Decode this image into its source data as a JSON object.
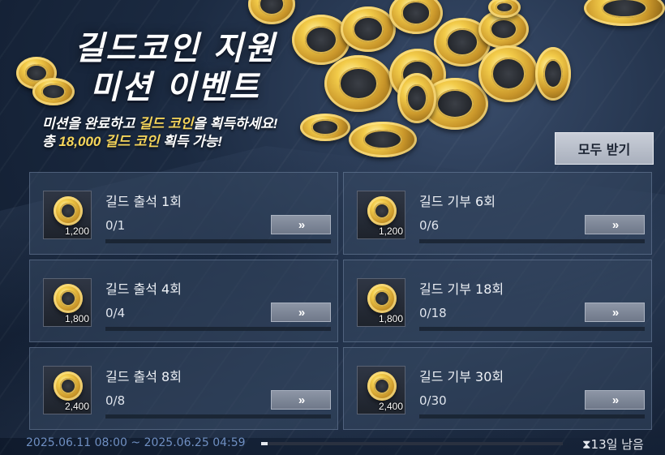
{
  "event": {
    "title_line1": "길드코인 지원",
    "title_line2": "미션 이벤트",
    "subtitle_line1_pre": "미션을 완료하고 ",
    "subtitle_line1_hl": "길드 코인",
    "subtitle_line1_post": "을 획득하세요!",
    "subtitle_line2_pre": "총 ",
    "subtitle_line2_hl": "18,000 길드 코인",
    "subtitle_line2_post": " 획득 가능!",
    "claim_all_label": "모두 받기"
  },
  "missions": [
    {
      "name": "길드 출석 1회",
      "progress": "0/1",
      "reward": "1,200",
      "go_label": "»"
    },
    {
      "name": "길드 기부 6회",
      "progress": "0/6",
      "reward": "1,200",
      "go_label": "»"
    },
    {
      "name": "길드 출석 4회",
      "progress": "0/4",
      "reward": "1,800",
      "go_label": "»"
    },
    {
      "name": "길드 기부 18회",
      "progress": "0/18",
      "reward": "1,800",
      "go_label": "»"
    },
    {
      "name": "길드 출석 8회",
      "progress": "0/8",
      "reward": "2,400",
      "go_label": "»"
    },
    {
      "name": "길드 기부 30회",
      "progress": "0/30",
      "reward": "2,400",
      "go_label": "»"
    }
  ],
  "footer": {
    "period": "2025.06.11 08:00 ~ 2025.06.25 04:59",
    "remaining": "13일 남음",
    "hourglass_icon": "hourglass-icon"
  },
  "colors": {
    "highlight": "#f6d55a",
    "period_text": "#6f8fc2"
  }
}
